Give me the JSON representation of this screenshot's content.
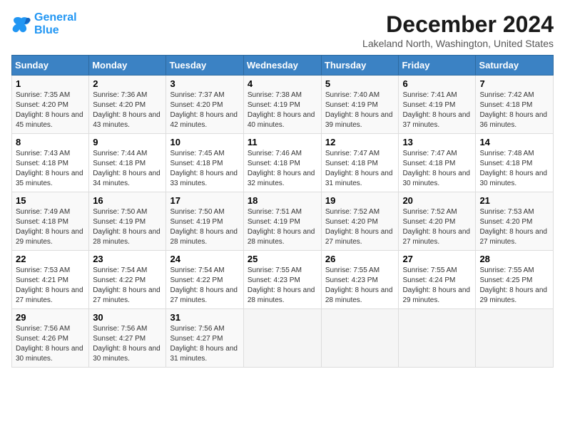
{
  "header": {
    "logo_line1": "General",
    "logo_line2": "Blue",
    "month_title": "December 2024",
    "subtitle": "Lakeland North, Washington, United States"
  },
  "weekdays": [
    "Sunday",
    "Monday",
    "Tuesday",
    "Wednesday",
    "Thursday",
    "Friday",
    "Saturday"
  ],
  "weeks": [
    [
      {
        "day": "1",
        "sunrise": "7:35 AM",
        "sunset": "4:20 PM",
        "daylight": "8 hours and 45 minutes."
      },
      {
        "day": "2",
        "sunrise": "7:36 AM",
        "sunset": "4:20 PM",
        "daylight": "8 hours and 43 minutes."
      },
      {
        "day": "3",
        "sunrise": "7:37 AM",
        "sunset": "4:20 PM",
        "daylight": "8 hours and 42 minutes."
      },
      {
        "day": "4",
        "sunrise": "7:38 AM",
        "sunset": "4:19 PM",
        "daylight": "8 hours and 40 minutes."
      },
      {
        "day": "5",
        "sunrise": "7:40 AM",
        "sunset": "4:19 PM",
        "daylight": "8 hours and 39 minutes."
      },
      {
        "day": "6",
        "sunrise": "7:41 AM",
        "sunset": "4:19 PM",
        "daylight": "8 hours and 37 minutes."
      },
      {
        "day": "7",
        "sunrise": "7:42 AM",
        "sunset": "4:18 PM",
        "daylight": "8 hours and 36 minutes."
      }
    ],
    [
      {
        "day": "8",
        "sunrise": "7:43 AM",
        "sunset": "4:18 PM",
        "daylight": "8 hours and 35 minutes."
      },
      {
        "day": "9",
        "sunrise": "7:44 AM",
        "sunset": "4:18 PM",
        "daylight": "8 hours and 34 minutes."
      },
      {
        "day": "10",
        "sunrise": "7:45 AM",
        "sunset": "4:18 PM",
        "daylight": "8 hours and 33 minutes."
      },
      {
        "day": "11",
        "sunrise": "7:46 AM",
        "sunset": "4:18 PM",
        "daylight": "8 hours and 32 minutes."
      },
      {
        "day": "12",
        "sunrise": "7:47 AM",
        "sunset": "4:18 PM",
        "daylight": "8 hours and 31 minutes."
      },
      {
        "day": "13",
        "sunrise": "7:47 AM",
        "sunset": "4:18 PM",
        "daylight": "8 hours and 30 minutes."
      },
      {
        "day": "14",
        "sunrise": "7:48 AM",
        "sunset": "4:18 PM",
        "daylight": "8 hours and 30 minutes."
      }
    ],
    [
      {
        "day": "15",
        "sunrise": "7:49 AM",
        "sunset": "4:18 PM",
        "daylight": "8 hours and 29 minutes."
      },
      {
        "day": "16",
        "sunrise": "7:50 AM",
        "sunset": "4:19 PM",
        "daylight": "8 hours and 28 minutes."
      },
      {
        "day": "17",
        "sunrise": "7:50 AM",
        "sunset": "4:19 PM",
        "daylight": "8 hours and 28 minutes."
      },
      {
        "day": "18",
        "sunrise": "7:51 AM",
        "sunset": "4:19 PM",
        "daylight": "8 hours and 28 minutes."
      },
      {
        "day": "19",
        "sunrise": "7:52 AM",
        "sunset": "4:20 PM",
        "daylight": "8 hours and 27 minutes."
      },
      {
        "day": "20",
        "sunrise": "7:52 AM",
        "sunset": "4:20 PM",
        "daylight": "8 hours and 27 minutes."
      },
      {
        "day": "21",
        "sunrise": "7:53 AM",
        "sunset": "4:20 PM",
        "daylight": "8 hours and 27 minutes."
      }
    ],
    [
      {
        "day": "22",
        "sunrise": "7:53 AM",
        "sunset": "4:21 PM",
        "daylight": "8 hours and 27 minutes."
      },
      {
        "day": "23",
        "sunrise": "7:54 AM",
        "sunset": "4:22 PM",
        "daylight": "8 hours and 27 minutes."
      },
      {
        "day": "24",
        "sunrise": "7:54 AM",
        "sunset": "4:22 PM",
        "daylight": "8 hours and 27 minutes."
      },
      {
        "day": "25",
        "sunrise": "7:55 AM",
        "sunset": "4:23 PM",
        "daylight": "8 hours and 28 minutes."
      },
      {
        "day": "26",
        "sunrise": "7:55 AM",
        "sunset": "4:23 PM",
        "daylight": "8 hours and 28 minutes."
      },
      {
        "day": "27",
        "sunrise": "7:55 AM",
        "sunset": "4:24 PM",
        "daylight": "8 hours and 29 minutes."
      },
      {
        "day": "28",
        "sunrise": "7:55 AM",
        "sunset": "4:25 PM",
        "daylight": "8 hours and 29 minutes."
      }
    ],
    [
      {
        "day": "29",
        "sunrise": "7:56 AM",
        "sunset": "4:26 PM",
        "daylight": "8 hours and 30 minutes."
      },
      {
        "day": "30",
        "sunrise": "7:56 AM",
        "sunset": "4:27 PM",
        "daylight": "8 hours and 30 minutes."
      },
      {
        "day": "31",
        "sunrise": "7:56 AM",
        "sunset": "4:27 PM",
        "daylight": "8 hours and 31 minutes."
      },
      null,
      null,
      null,
      null
    ]
  ]
}
